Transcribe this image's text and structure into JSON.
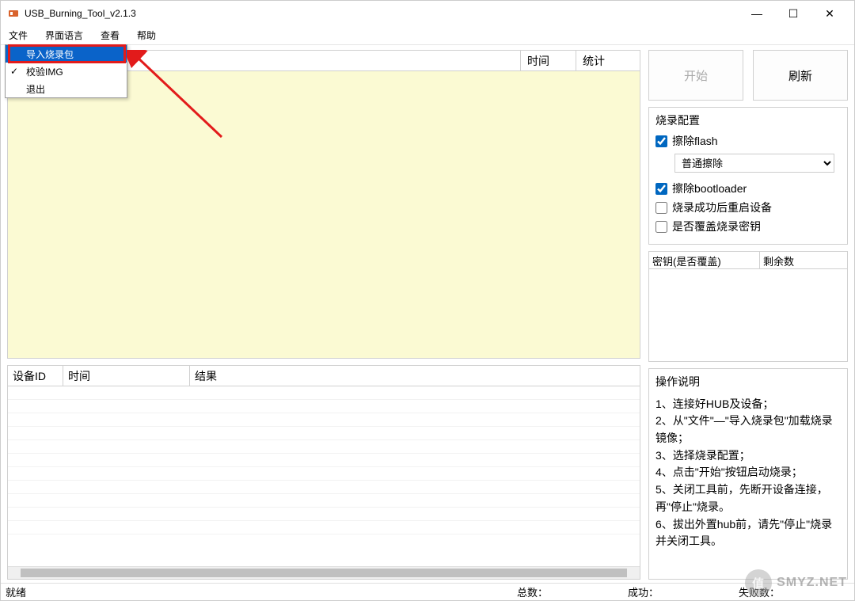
{
  "window": {
    "title": "USB_Burning_Tool_v2.1.3"
  },
  "menubar": {
    "file": "文件",
    "lang": "界面语言",
    "view": "查看",
    "help": "帮助"
  },
  "file_menu": {
    "import": "导入烧录包",
    "verify": "校验IMG",
    "exit": "退出"
  },
  "top_table": {
    "col_blank": "",
    "col_time": "时间",
    "col_stats": "统计"
  },
  "bottom_table": {
    "col_devid": "设备ID",
    "col_time": "时间",
    "col_result": "结果"
  },
  "buttons": {
    "start": "开始",
    "refresh": "刷新"
  },
  "config": {
    "title": "烧录配置",
    "erase_flash": "擦除flash",
    "erase_mode": "普通擦除",
    "erase_bootloader": "擦除bootloader",
    "reboot_after": "烧录成功后重启设备",
    "overwrite_key": "是否覆盖烧录密钥"
  },
  "keys": {
    "col_key": "密钥(是否覆盖)",
    "col_remain": "剩余数"
  },
  "instructions": {
    "title": "操作说明",
    "line1": "1、连接好HUB及设备；",
    "line2": "2、从\"文件\"—\"导入烧录包\"加载烧录镜像；",
    "line3": "3、选择烧录配置；",
    "line4": "4、点击\"开始\"按钮启动烧录；",
    "line5": "5、关闭工具前，先断开设备连接，再\"停止\"烧录。",
    "line6": "6、拔出外置hub前，请先\"停止\"烧录并关闭工具。"
  },
  "statusbar": {
    "ready": "就绪",
    "total": "总数：",
    "success": "成功：",
    "fail": "失败数："
  },
  "watermark": {
    "badge": "值",
    "text": "SMYZ.NET"
  }
}
